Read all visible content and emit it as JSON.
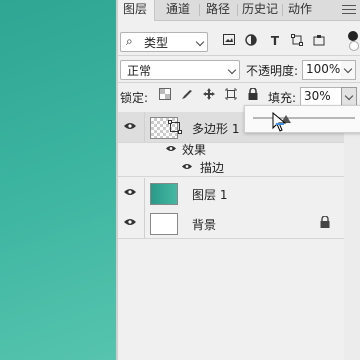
{
  "tabs": [
    {
      "label": "图层"
    },
    {
      "label": "通道"
    },
    {
      "label": "路径"
    },
    {
      "label": "历史记"
    },
    {
      "label": "动作"
    }
  ],
  "filter": {
    "search_glyph": "⌕",
    "kind_label": "类型"
  },
  "blend": {
    "mode": "正常",
    "opacity_label": "不透明度:",
    "opacity_value": "100%"
  },
  "lock": {
    "label": "锁定:",
    "fill_label": "填充:",
    "fill_value": "30%"
  },
  "layers": [
    {
      "name": "多边形 1",
      "selected": true,
      "visible": true
    },
    {
      "name": "图层 1",
      "visible": true
    },
    {
      "name": "背景",
      "visible": true,
      "locked": true
    }
  ],
  "effects": {
    "group_label": "效果",
    "items": [
      {
        "label": "描边"
      }
    ]
  },
  "colors": {
    "canvas_teal": "#3ab39f",
    "panel_bg": "#f0f0f0"
  }
}
